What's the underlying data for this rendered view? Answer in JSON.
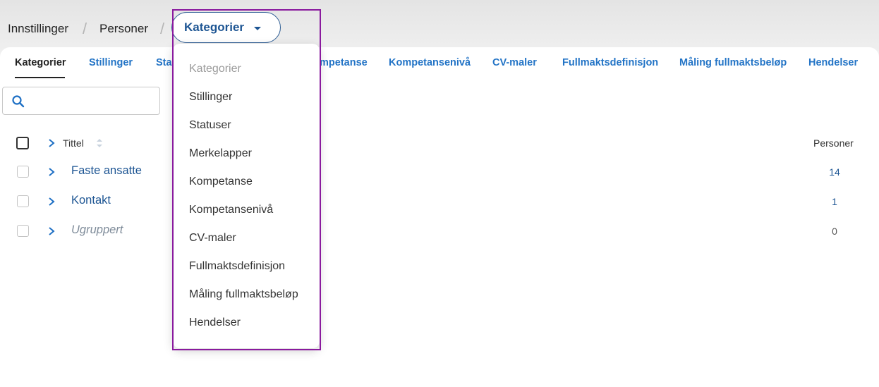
{
  "breadcrumb": {
    "items": [
      "Innstillinger",
      "Personer"
    ],
    "current": "Kategorier"
  },
  "tabs": [
    {
      "label": "Kategorier",
      "active": true
    },
    {
      "label": "Stillinger"
    },
    {
      "label": "Sta"
    },
    {
      "label": "mpetanse"
    },
    {
      "label": "Kompetansenivå"
    },
    {
      "label": "CV-maler"
    },
    {
      "label": "Fullmaktsdefinisjon"
    },
    {
      "label": "Måling fullmaktsbeløp"
    },
    {
      "label": "Hendelser"
    }
  ],
  "search": {
    "placeholder": "",
    "value": ""
  },
  "table": {
    "headers": {
      "title": "Tittel",
      "count": "Personer"
    },
    "rows": [
      {
        "title": "Faste ansatte",
        "count": "14"
      },
      {
        "title": "Kontakt",
        "count": "1"
      },
      {
        "title": "Ugruppert",
        "count": "0",
        "muted": true
      }
    ]
  },
  "dropdown": {
    "items": [
      "Kategorier",
      "Stillinger",
      "Statuser",
      "Merkelapper",
      "Kompetanse",
      "Kompetansenivå",
      "CV-maler",
      "Fullmaktsdefinisjon",
      "Måling fullmaktsbeløp",
      "Hendelser"
    ]
  },
  "colors": {
    "link": "#2374c6",
    "accent": "#1d5593",
    "highlight": "#8a1a9e"
  }
}
